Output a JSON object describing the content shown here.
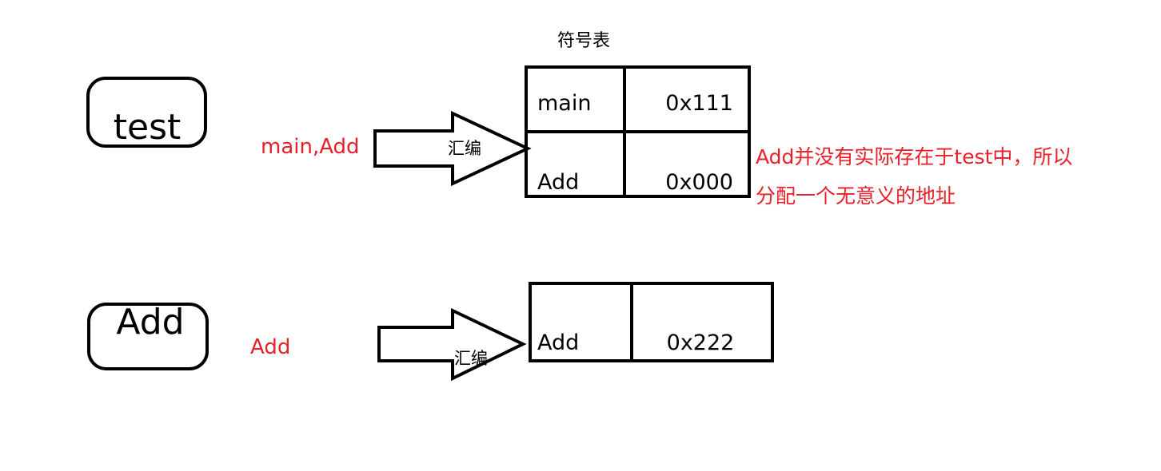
{
  "symbol_table_title": "符号表",
  "test_module": {
    "label": "test",
    "symbols_text": "main,Add",
    "arrow_label": "汇编",
    "table": [
      {
        "name": "main",
        "address": "0x111"
      },
      {
        "name": "Add",
        "address": "0x000"
      }
    ],
    "note_line1": "Add并没有实际存在于test中，所以",
    "note_line2": "分配一个无意义的地址"
  },
  "add_module": {
    "label": "Add",
    "symbols_text": "Add",
    "arrow_label": "汇编",
    "table": [
      {
        "name": "Add",
        "address": "0x222"
      }
    ]
  },
  "colors": {
    "annotation": "#e8202a",
    "stroke": "#000000"
  }
}
